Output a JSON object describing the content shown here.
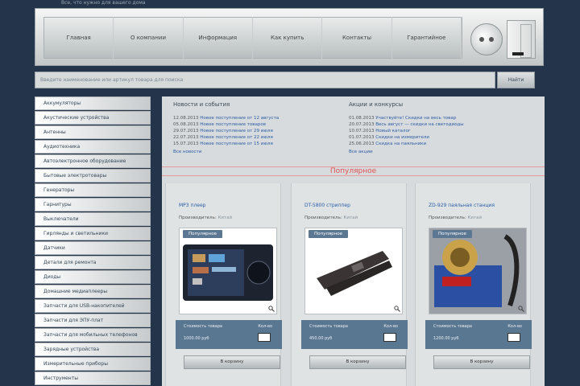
{
  "header": {
    "tagline": "Все, что нужно для вашего дома",
    "nav": [
      "Главная",
      "О компании",
      "Информация",
      "Как купить",
      "Контакты",
      "Гарантийное"
    ]
  },
  "search": {
    "placeholder": "Введите наименование или артикул товара для поиска",
    "button": "Найти"
  },
  "sidebar": {
    "items": [
      "Аккумуляторы",
      "Акустические устройства",
      "Антенны",
      "Аудиотехника",
      "Автоэлектронное оборудование",
      "Бытовые электротовары",
      "Генераторы",
      "Гарнитуры",
      "Выключатели",
      "Гирлянды и светильники",
      "Датчики",
      "Детали для ремонта",
      "Диоды",
      "Домашние медиаплееры",
      "Запчасти для USB-накопителей",
      "Запчасти для ЭПУ-плат",
      "Запчасти для мобильных телефонов",
      "Зарядные устройства",
      "Измерительные приборы",
      "Инструменты"
    ]
  },
  "news": {
    "title": "Новости и события",
    "items": [
      {
        "date": "12.08.2013",
        "text": "Новое поступление от 12 августа"
      },
      {
        "date": "05.08.2013",
        "text": "Новое поступление товаров"
      },
      {
        "date": "29.07.2013",
        "text": "Новое поступление от 29 июля"
      },
      {
        "date": "22.07.2013",
        "text": "Новое поступление от 22 июля"
      },
      {
        "date": "15.07.2013",
        "text": "Новое поступление от 15 июля"
      }
    ],
    "more": "Все новости"
  },
  "promo": {
    "title": "Акции и конкурсы",
    "items": [
      {
        "date": "01.08.2013",
        "text": "Участвуйте! Скидки на весь товар"
      },
      {
        "date": "20.07.2013",
        "text": "Весь август — скидки на светодиоды"
      },
      {
        "date": "10.07.2013",
        "text": "Новый каталог"
      },
      {
        "date": "01.07.2013",
        "text": "Скидки на измерители"
      },
      {
        "date": "25.06.2013",
        "text": "Скидка на паяльники"
      }
    ],
    "more": "Все акции"
  },
  "popular_label": "Популярное",
  "products": [
    {
      "name": "MP3 плеер",
      "maker_label": "Производитель:",
      "maker": "Китай",
      "tag": "Популярное",
      "price_label": "Стоимость товара",
      "price": "1000.00 руб",
      "qty_label": "Кол-во",
      "cart": "В корзину"
    },
    {
      "name": "DT-5800 стриппер",
      "maker_label": "Производитель:",
      "maker": "Китай",
      "tag": "Популярное",
      "price_label": "Стоимость товара",
      "price": "450.00 руб",
      "qty_label": "Кол-во",
      "cart": "В корзину"
    },
    {
      "name": "ZD-929 паяльная станция",
      "maker_label": "Производитель:",
      "maker": "Китай",
      "tag": "Популярное",
      "price_label": "Стоимость товара",
      "price": "1200.00 руб",
      "qty_label": "Кол-во",
      "cart": "В корзину"
    }
  ],
  "colors": {
    "background": "#24344a",
    "accent": "#5a7791",
    "link": "#2b5ca8",
    "popular": "#e05050"
  }
}
